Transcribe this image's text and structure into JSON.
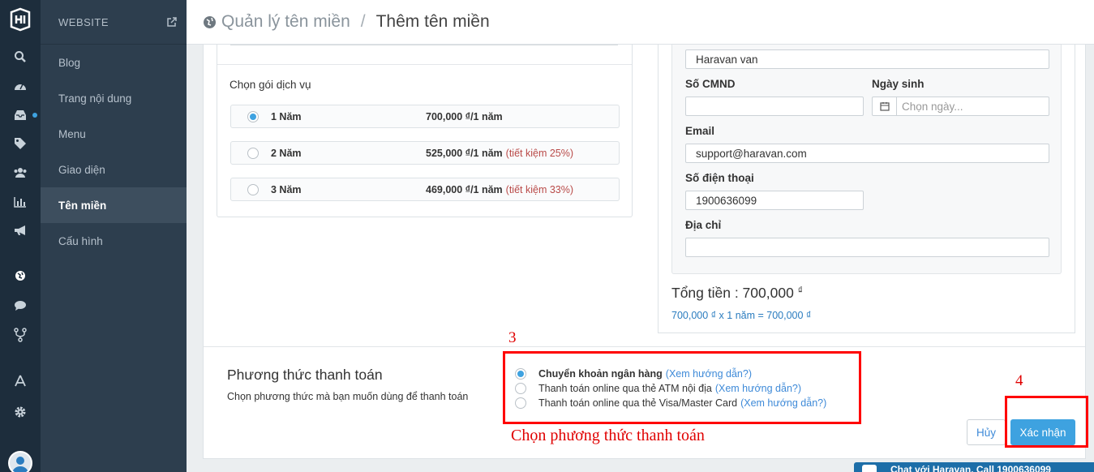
{
  "sidebar": {
    "section_title": "WEBSITE",
    "items": [
      {
        "label": "Blog",
        "active": false
      },
      {
        "label": "Trang nội dung",
        "active": false
      },
      {
        "label": "Menu",
        "active": false
      },
      {
        "label": "Giao diện",
        "active": false
      },
      {
        "label": "Tên miền",
        "active": true
      },
      {
        "label": "Cấu hình",
        "active": false
      }
    ],
    "rail_icons": [
      "logo-icon",
      "search-icon",
      "dashboard-icon",
      "inbox-icon",
      "tag-icon",
      "users-icon",
      "bar-chart-icon",
      "megaphone-icon",
      "globe-icon",
      "chat-icon",
      "fork-icon",
      "appstore-icon",
      "gear-icon",
      "avatar"
    ]
  },
  "header": {
    "breadcrumb_parent": "Quản lý tên miền",
    "breadcrumb_sep": "/",
    "breadcrumb_current": "Thêm tên miền"
  },
  "packages": {
    "title": "Chọn gói dịch vụ",
    "options": [
      {
        "name": "1 Năm",
        "price": "700,000 ₫/1 năm",
        "saving": "",
        "selected": true
      },
      {
        "name": "2 Năm",
        "price": "525,000 ₫/1 năm",
        "saving": "(tiết kiệm 25%)",
        "selected": false
      },
      {
        "name": "3 Năm",
        "price": "469,000 ₫/1 năm",
        "saving": "(tiết kiệm 33%)",
        "selected": false
      }
    ]
  },
  "form": {
    "name_value": "Haravan van",
    "id_label": "Số CMND",
    "id_value": "",
    "dob_label": "Ngày sinh",
    "dob_placeholder": "Chọn ngày...",
    "email_label": "Email",
    "email_value": "support@haravan.com",
    "phone_label": "Số điện thoại",
    "phone_value": "1900636099",
    "address_label": "Địa chỉ",
    "address_value": ""
  },
  "summary": {
    "total_label": "Tổng tiền : 700,000",
    "currency": "₫",
    "calc": "700,000 ₫ x 1 năm = 700,000 ₫"
  },
  "payment": {
    "title": "Phương thức thanh toán",
    "subtitle": "Chọn phương thức mà bạn muốn dùng để thanh toán",
    "options": [
      {
        "label": "Chuyển khoản ngân hàng",
        "link": "(Xem hướng dẫn?)",
        "selected": true,
        "bold": true
      },
      {
        "label": "Thanh toán online qua thẻ ATM nội địa",
        "link": "(Xem hướng dẫn?)",
        "selected": false,
        "bold": false
      },
      {
        "label": "Thanh toán online qua thẻ Visa/Master Card",
        "link": "(Xem hướng dẫn?)",
        "selected": false,
        "bold": false
      }
    ],
    "cancel_label": "Hủy",
    "confirm_label": "Xác nhận"
  },
  "annotations": {
    "num3": "3",
    "num4": "4",
    "caption": "Chọn phương thức thanh toán"
  },
  "chat": {
    "label": "Chat với Haravan, Call 1900636099"
  },
  "colors": {
    "rail_bg": "#1d2d3c",
    "subnav_bg": "#2d3e4e",
    "accent": "#3ea2e0",
    "link": "#3e8ad8",
    "annotation_red": "#ff0000"
  }
}
